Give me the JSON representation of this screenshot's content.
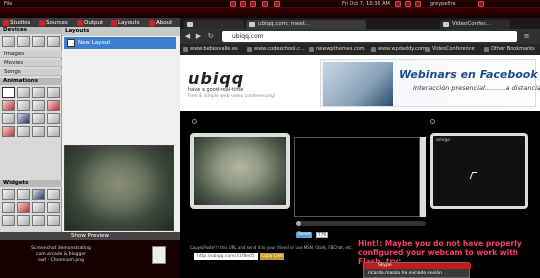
{
  "topbar": {
    "app_menu": "File",
    "clock": "Fri Oct 7, 10:36 AM",
    "user": "greypefire"
  },
  "app": {
    "tabs": [
      "Studios",
      "Sources",
      "Output",
      "Layouts",
      "About"
    ],
    "sidebar": {
      "devices": "Devices",
      "items": [
        "Images",
        "Movies",
        "Songs"
      ],
      "animations": "Animations",
      "widgets": "Widgets"
    },
    "layouts_header": "Layouts",
    "new_layout": "New Layout",
    "show_preview": "Show Preview"
  },
  "desktop": {
    "file_caption_1": "Screenshot demonstrating",
    "file_caption_2": "com.arcade & blogger",
    "file_caption_3": "owf - Chromium.png"
  },
  "browser": {
    "tabs": [
      "",
      "ubiqq.com: meet...",
      "VideoConfer..."
    ],
    "url": "ubiqq.com",
    "bookmarks": [
      "www.bebesvalle.es",
      "www.codeschool.c...",
      "newwpthemes.com",
      "www.wpdaddy.com",
      "VideoConference",
      "Other Bookmarks"
    ],
    "page": {
      "logo": "ubiqq",
      "tagline": "have a good-real-time",
      "tagline2": "Free & simple web video conferencing!",
      "banner_title": "Webinars en Facebook",
      "banner_sub": "Interacción presencial..........a distancia",
      "chat_caption": "amigo",
      "tweet": "Tweet",
      "tweet_count": "776",
      "copy_text": "Copy&Paste!!! this URL and send it to your friend or use MSN, Gtalk, FBChat, etc.",
      "link_value": "http://ubiqq.com/31f8e05",
      "link_button": "Copy Link",
      "hint": "Hint!: Maybe you do not have properly configured your webcam to work with Flash, try:",
      "progress": 0.04
    }
  },
  "notification": {
    "title": "Skype",
    "text": "ricardo.manzo ha iniciado sesión"
  }
}
